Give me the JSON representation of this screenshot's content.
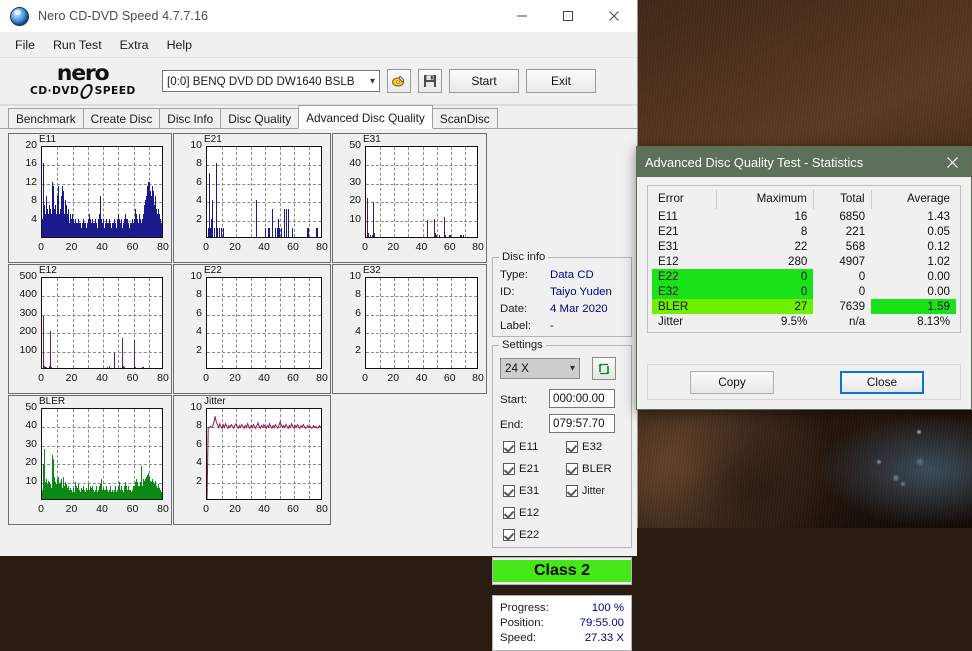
{
  "window": {
    "title": "Nero CD-DVD Speed 4.7.7.16",
    "icon": "nero-app-icon",
    "controls": {
      "minimize": "minimize-icon",
      "maximize": "maximize-icon",
      "close": "close-icon"
    }
  },
  "menu": {
    "items": [
      "File",
      "Run Test",
      "Extra",
      "Help"
    ]
  },
  "brand": {
    "logo_word": "nero",
    "logo_sub_left": "CD·DVD",
    "logo_sub_right": "SPEED",
    "drive": "[0:0]   BENQ DVD DD DW1640 BSLB",
    "drive_chevron": "chevron-down-icon",
    "eject_icon": "eject-disc-icon",
    "save_icon": "floppy-save-icon",
    "start_label": "Start",
    "exit_label": "Exit"
  },
  "tabs": {
    "items": [
      "Benchmark",
      "Create Disc",
      "Disc Info",
      "Disc Quality",
      "Advanced Disc Quality",
      "ScanDisc"
    ],
    "active": "Advanced Disc Quality"
  },
  "disc_info": {
    "group_title": "Disc info",
    "rows": [
      {
        "key": "Type:",
        "value": "Data CD"
      },
      {
        "key": "ID:",
        "value": "Taiyo Yuden"
      },
      {
        "key": "Date:",
        "value": "4 Mar 2020"
      },
      {
        "key": "Label:",
        "value": "-"
      }
    ]
  },
  "settings": {
    "group_title": "Settings",
    "speed": "24 X",
    "speed_chevron": "chevron-down-icon",
    "refresh_icon": "refresh-icon",
    "start_label": "Start:",
    "start_value": "000:00.00",
    "end_label": "End:",
    "end_value": "079:57.70",
    "checkboxes_left": [
      "E11",
      "E21",
      "E31",
      "E12",
      "E22"
    ],
    "checkboxes_right": [
      "E32",
      "BLER",
      "Jitter"
    ]
  },
  "class_result": {
    "label": "Class 2",
    "color": "#45e817"
  },
  "progress": {
    "rows": [
      {
        "key": "Progress:",
        "value": "100 %"
      },
      {
        "key": "Position:",
        "value": "79:55.00"
      },
      {
        "key": "Speed:",
        "value": "27.33 X"
      }
    ]
  },
  "dialog": {
    "title": "Advanced Disc Quality Test - Statistics",
    "close_icon": "close-icon",
    "headers": [
      "Error",
      "Maximum",
      "Total",
      "Average"
    ],
    "rows": [
      {
        "error": "E11",
        "maximum": "16",
        "total": "6850",
        "average": "1.43",
        "highlight": "none"
      },
      {
        "error": "E21",
        "maximum": "8",
        "total": "221",
        "average": "0.05",
        "highlight": "none"
      },
      {
        "error": "E31",
        "maximum": "22",
        "total": "568",
        "average": "0.12",
        "highlight": "none"
      },
      {
        "error": "E12",
        "maximum": "280",
        "total": "4907",
        "average": "1.02",
        "highlight": "none"
      },
      {
        "error": "E22",
        "maximum": "0",
        "total": "0",
        "average": "0.00",
        "highlight": "green-left"
      },
      {
        "error": "E32",
        "maximum": "0",
        "total": "0",
        "average": "0.00",
        "highlight": "green-left"
      },
      {
        "error": "BLER",
        "maximum": "27",
        "total": "7639",
        "average": "1.59",
        "highlight": "bler"
      },
      {
        "error": "Jitter",
        "maximum": "9.5%",
        "total": "n/a",
        "average": "8.13%",
        "highlight": "none"
      }
    ],
    "copy_label": "Copy",
    "close_label": "Close"
  },
  "chart_data": [
    {
      "type": "bar",
      "title": "E11",
      "xlabel": "",
      "ylabel": "",
      "xlim": [
        0,
        80
      ],
      "ylim": [
        0,
        20
      ],
      "yticks": [
        4,
        8,
        12,
        16,
        20
      ],
      "xticks": [
        0,
        20,
        40,
        60,
        80
      ],
      "color": "#1a1a8c",
      "grid": true,
      "values": [
        4,
        16,
        6,
        7,
        5,
        9,
        6,
        5,
        4,
        7,
        6,
        5,
        12,
        11,
        8,
        6,
        7,
        5,
        9,
        6,
        11,
        5,
        6,
        9,
        4,
        11,
        10,
        5,
        8,
        7,
        5,
        4,
        6,
        3,
        5,
        4,
        3,
        5,
        4,
        3,
        4,
        3,
        2,
        3,
        4,
        3,
        2,
        3,
        2,
        3,
        4,
        3,
        2,
        3,
        2,
        3,
        4,
        3,
        5,
        4,
        3,
        4,
        3,
        2,
        3,
        4,
        3,
        2,
        3,
        4,
        5,
        9,
        4,
        3,
        4,
        3,
        2,
        3,
        4,
        3,
        2,
        3,
        4,
        3,
        2,
        3,
        2,
        3,
        4,
        3,
        2,
        3,
        4,
        5,
        4,
        3,
        4,
        3,
        2,
        3,
        4,
        5,
        4,
        3,
        4,
        3,
        2,
        3,
        2,
        3,
        4,
        3,
        4,
        5,
        6,
        5,
        4,
        3,
        4,
        5,
        4,
        3,
        4,
        5,
        6,
        7,
        8,
        9,
        11,
        12,
        11,
        12,
        10,
        9,
        11,
        10,
        8,
        7,
        9,
        6,
        5,
        4,
        6,
        5,
        4,
        3,
        5,
        4,
        6
      ]
    },
    {
      "type": "bar",
      "title": "E21",
      "xlabel": "",
      "ylabel": "",
      "xlim": [
        0,
        80
      ],
      "ylim": [
        0,
        10
      ],
      "yticks": [
        2,
        4,
        6,
        8,
        10
      ],
      "xticks": [
        0,
        20,
        40,
        60,
        80
      ],
      "color": "#1a1a8c",
      "grid": true,
      "values": [
        0,
        1,
        2,
        7,
        1,
        2,
        4,
        1,
        0,
        1,
        0,
        1,
        8,
        1,
        0,
        1,
        1,
        0,
        1,
        0,
        1,
        0,
        0,
        0,
        0,
        0,
        0,
        0,
        0,
        0,
        0,
        0,
        0,
        0,
        0,
        0,
        0,
        0,
        0,
        0,
        0,
        0,
        0,
        0,
        0,
        0,
        0,
        0,
        0,
        0,
        0,
        0,
        0,
        0,
        0,
        0,
        0,
        0,
        0,
        0,
        0,
        0,
        0,
        4,
        0,
        0,
        0,
        0,
        0,
        0,
        0,
        0,
        0,
        0,
        0,
        1,
        0,
        0,
        1,
        1,
        0,
        0,
        0,
        0,
        3,
        0,
        0,
        1,
        0,
        0,
        1,
        2,
        0,
        1,
        0,
        1,
        0,
        0,
        0,
        3,
        0,
        3,
        0,
        0,
        3,
        0,
        0,
        0,
        0,
        1,
        0,
        0,
        0,
        0,
        0,
        0,
        0,
        0,
        0,
        0,
        0,
        0,
        0,
        0,
        0,
        0,
        0,
        0,
        1,
        0,
        1,
        0,
        0,
        0,
        0,
        0,
        0,
        0,
        0,
        0,
        1,
        1,
        0,
        0,
        0,
        0,
        0,
        0,
        0
      ]
    },
    {
      "type": "bar",
      "title": "E31",
      "xlabel": "",
      "ylabel": "",
      "xlim": [
        0,
        80
      ],
      "ylim": [
        0,
        50
      ],
      "yticks": [
        10,
        20,
        30,
        40,
        50
      ],
      "xticks": [
        0,
        20,
        40,
        60,
        80
      ],
      "color": "#4b1a6e",
      "grid": true,
      "values": [
        0,
        21,
        2,
        1,
        0,
        1,
        0,
        0,
        1,
        19,
        2,
        1,
        0,
        0,
        0,
        0,
        0,
        0,
        0,
        0,
        0,
        0,
        0,
        0,
        0,
        0,
        0,
        0,
        0,
        0,
        0,
        0,
        0,
        0,
        0,
        0,
        0,
        0,
        0,
        0,
        0,
        0,
        0,
        0,
        0,
        0,
        0,
        0,
        0,
        0,
        0,
        0,
        0,
        0,
        0,
        0,
        0,
        0,
        0,
        0,
        0,
        0,
        0,
        0,
        0,
        0,
        0,
        0,
        0,
        0,
        0,
        0,
        0,
        0,
        0,
        0,
        0,
        0,
        0,
        0,
        9,
        0,
        0,
        0,
        0,
        0,
        0,
        0,
        0,
        10,
        2,
        1,
        0,
        0,
        0,
        1,
        0,
        0,
        0,
        0,
        0,
        11,
        2,
        1,
        0,
        0,
        0,
        0,
        1,
        1,
        0,
        0,
        0,
        0,
        0,
        0,
        0,
        0,
        0,
        0,
        0,
        0,
        1,
        1,
        1,
        0,
        1,
        0,
        0,
        0,
        0,
        0,
        0,
        0,
        0,
        0,
        0,
        0,
        0,
        0,
        0,
        0,
        0,
        0,
        0,
        0,
        0
      ]
    },
    {
      "type": "bar",
      "title": "E12",
      "xlabel": "",
      "ylabel": "",
      "xlim": [
        0,
        80
      ],
      "ylim": [
        0,
        500
      ],
      "yticks": [
        100,
        200,
        300,
        400,
        500
      ],
      "xticks": [
        0,
        20,
        40,
        60,
        80
      ],
      "color": "#6b1a6b",
      "grid": true,
      "values": [
        0,
        280,
        10,
        8,
        5,
        4,
        0,
        0,
        10,
        200,
        12,
        6,
        0,
        0,
        0,
        0,
        0,
        0,
        0,
        0,
        0,
        0,
        0,
        0,
        0,
        0,
        0,
        0,
        0,
        0,
        0,
        0,
        0,
        0,
        0,
        0,
        0,
        0,
        0,
        0,
        0,
        0,
        0,
        0,
        0,
        0,
        0,
        0,
        0,
        0,
        0,
        0,
        0,
        0,
        0,
        0,
        0,
        0,
        0,
        0,
        0,
        0,
        0,
        0,
        0,
        0,
        0,
        0,
        0,
        0,
        0,
        0,
        0,
        0,
        0,
        0,
        0,
        8,
        0,
        0,
        10,
        0,
        0,
        0,
        0,
        80,
        0,
        0,
        0,
        0,
        0,
        0,
        0,
        0,
        0,
        165,
        12,
        5,
        0,
        0,
        0,
        0,
        0,
        0,
        0,
        0,
        0,
        0,
        0,
        150,
        8,
        4,
        0,
        0,
        0,
        0,
        0,
        0,
        0,
        8,
        6,
        0,
        0,
        0,
        0,
        0,
        0,
        0,
        0,
        0,
        0,
        0,
        0,
        0,
        0,
        0,
        0,
        0,
        0,
        0,
        0,
        0,
        0,
        0,
        0
      ]
    },
    {
      "type": "bar",
      "title": "E22",
      "xlabel": "",
      "ylabel": "",
      "xlim": [
        0,
        80
      ],
      "ylim": [
        0,
        10
      ],
      "yticks": [
        2,
        4,
        6,
        8,
        10
      ],
      "xticks": [
        0,
        20,
        40,
        60,
        80
      ],
      "color": "#1a1a8c",
      "grid": true,
      "values": []
    },
    {
      "type": "bar",
      "title": "E32",
      "xlabel": "",
      "ylabel": "",
      "xlim": [
        0,
        80
      ],
      "ylim": [
        0,
        10
      ],
      "yticks": [
        2,
        4,
        6,
        8,
        10
      ],
      "xticks": [
        0,
        20,
        40,
        60,
        80
      ],
      "color": "#1a1a8c",
      "grid": true,
      "values": []
    },
    {
      "type": "bar",
      "title": "BLER",
      "xlabel": "",
      "ylabel": "",
      "xlim": [
        0,
        80
      ],
      "ylim": [
        0,
        50
      ],
      "yticks": [
        10,
        20,
        30,
        40,
        50
      ],
      "xticks": [
        0,
        20,
        40,
        60,
        80
      ],
      "color": "#0a8a14",
      "grid": true,
      "values": [
        5,
        19,
        27,
        12,
        9,
        11,
        8,
        10,
        7,
        9,
        8,
        6,
        24,
        22,
        12,
        10,
        9,
        8,
        11,
        7,
        12,
        8,
        9,
        11,
        6,
        12,
        11,
        7,
        9,
        8,
        6,
        5,
        7,
        5,
        6,
        5,
        4,
        6,
        5,
        4,
        9,
        7,
        5,
        6,
        8,
        5,
        4,
        6,
        4,
        5,
        7,
        5,
        4,
        6,
        4,
        5,
        8,
        5,
        7,
        6,
        5,
        7,
        5,
        4,
        5,
        7,
        5,
        4,
        5,
        7,
        8,
        11,
        6,
        5,
        6,
        5,
        4,
        5,
        7,
        5,
        4,
        5,
        7,
        5,
        4,
        5,
        4,
        5,
        7,
        5,
        4,
        5,
        7,
        9,
        7,
        5,
        7,
        5,
        4,
        5,
        7,
        9,
        7,
        5,
        7,
        5,
        4,
        5,
        4,
        5,
        7,
        5,
        7,
        9,
        11,
        9,
        7,
        5,
        7,
        9,
        18,
        7,
        9,
        11,
        10,
        11,
        12,
        13,
        14,
        11,
        12,
        10,
        9,
        11,
        10,
        9,
        8,
        10,
        7,
        6,
        5,
        8,
        6,
        5,
        4,
        7,
        5,
        8
      ]
    },
    {
      "type": "line",
      "title": "Jitter",
      "xlabel": "",
      "ylabel": "",
      "xlim": [
        0,
        80
      ],
      "ylim": [
        0,
        10
      ],
      "yticks": [
        2,
        4,
        6,
        8,
        10
      ],
      "xticks": [
        0,
        20,
        40,
        60,
        80
      ],
      "color": "#8b1a52",
      "grid": true,
      "values": [
        0,
        7.9,
        8.0,
        8.1,
        8.0,
        8.2,
        8.6,
        9.2,
        8.6,
        8.3,
        8.0,
        8.4,
        8.1,
        7.9,
        8.3,
        8.0,
        8.4,
        8.1,
        7.9,
        8.2,
        8.0,
        8.3,
        8.1,
        7.9,
        8.2,
        8.4,
        8.1,
        7.9,
        8.2,
        8.0,
        8.3,
        8.1,
        7.9,
        8.2,
        8.0,
        8.4,
        8.1,
        7.9,
        8.2,
        8.0,
        8.3,
        8.1,
        7.9,
        8.2,
        8.5,
        8.1,
        7.9,
        8.2,
        8.0,
        8.3,
        8.1,
        7.9,
        8.2,
        8.0,
        8.4,
        8.1,
        7.9,
        8.2,
        8.0,
        8.3,
        8.1,
        7.9,
        8.2,
        8.6,
        8.3,
        8.0,
        8.2,
        8.0,
        8.3,
        8.1,
        7.9,
        8.2,
        8.0,
        8.4,
        8.1,
        7.9,
        8.2,
        8.0,
        8.3,
        8.1,
        7.9,
        8.2,
        8.0,
        8.3,
        8.1,
        7.9,
        8.0,
        8.2,
        8.0,
        8.1,
        7.9,
        8.0,
        8.2,
        8.0,
        8.1,
        7.9,
        8.0,
        8.2,
        8.0,
        8.1,
        8.0
      ]
    }
  ]
}
